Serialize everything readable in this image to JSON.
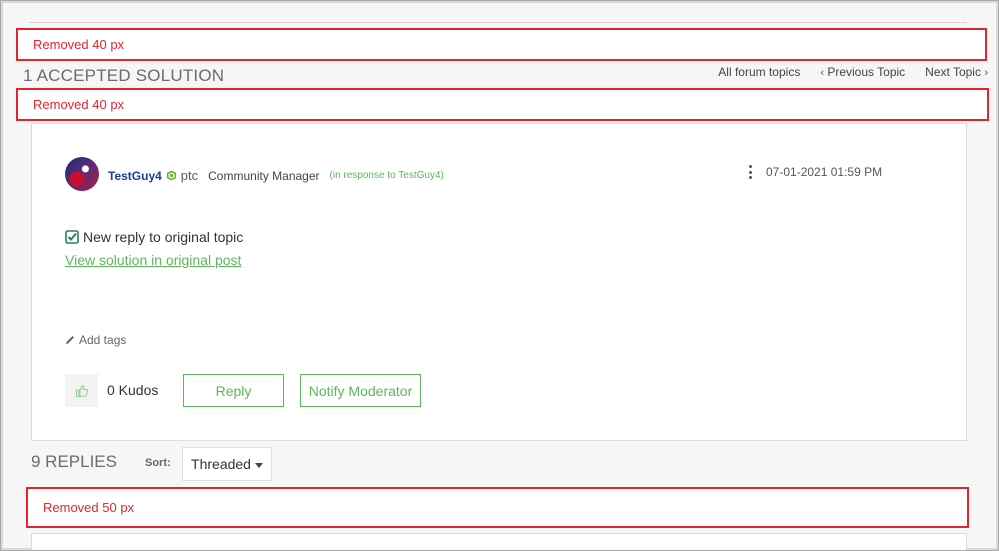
{
  "annotations": {
    "top_removed": "Removed 40 px",
    "middle_removed": "Removed 40 px",
    "bottom_removed": "Removed 50 px"
  },
  "section": {
    "title": "1 ACCEPTED SOLUTION"
  },
  "forum_nav": {
    "all_topics": "All forum topics",
    "previous": "Previous Topic",
    "next": "Next Topic",
    "prev_chevron": "‹",
    "next_chevron": "›"
  },
  "post": {
    "author": "TestGuy4",
    "company": "ptc",
    "role": "Community Manager",
    "in_response": "(in response to TestGuy4)",
    "date": "07-01-2021 01:59 PM",
    "reply_text": "New reply to original topic",
    "link_text": "View solution in original post",
    "add_tags": "Add tags",
    "kudos": "0 Kudos",
    "reply_button": "Reply",
    "notify_button": "Notify Moderator"
  },
  "replies": {
    "title": "9 REPLIES",
    "sort_label": "Sort:",
    "sort_value": "Threaded"
  },
  "colors": {
    "accent_green": "#5cb85c",
    "annotation_red": "#e2242d",
    "author_blue": "#1a3f9a"
  },
  "icons": {
    "badge": "ptc-badge-icon",
    "check": "checkbox-check-icon",
    "pencil": "pencil-icon",
    "thumbs": "thumbs-up-icon",
    "more": "more-options-icon",
    "caret": "caret-down-icon"
  }
}
